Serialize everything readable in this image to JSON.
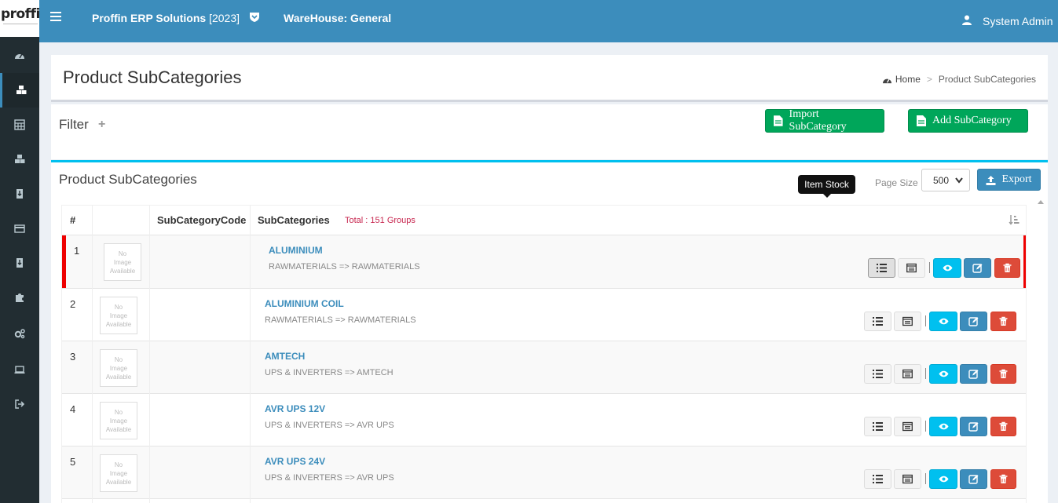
{
  "header": {
    "logo": "proffin",
    "app_title": "Proffin ERP Solutions",
    "app_year": "[2023]",
    "warehouse": "WareHouse: General",
    "user": "System Admin"
  },
  "sidebar": {
    "items": [
      {
        "icon": "dashboard-icon"
      },
      {
        "icon": "cubes-icon",
        "active": true
      },
      {
        "icon": "calculator-icon"
      },
      {
        "icon": "cubes-icon"
      },
      {
        "icon": "download-icon"
      },
      {
        "icon": "credit-card-icon"
      },
      {
        "icon": "download-icon"
      },
      {
        "icon": "puzzle-icon"
      },
      {
        "icon": "gears-icon"
      },
      {
        "icon": "laptop-icon"
      },
      {
        "icon": "sign-out-icon"
      }
    ]
  },
  "page": {
    "title": "Product SubCategories",
    "breadcrumb_home": "Home",
    "breadcrumb_current": "Product SubCategories"
  },
  "filter": {
    "label": "Filter",
    "plus": "+",
    "import_label": "Import SubCategory",
    "add_label": "Add SubCategory"
  },
  "list": {
    "title": "Product SubCategories",
    "page_size_label": "Page Size",
    "page_size_value": "500",
    "export_label": "Export",
    "columns": {
      "num": "#",
      "code": "SubCategoryCode",
      "name": "SubCategories",
      "total": "Total : 151 Groups"
    },
    "no_image": [
      "No",
      "Image",
      "Available"
    ],
    "tooltip": "Item Stock",
    "rows": [
      {
        "num": "1",
        "code": "",
        "name": "ALUMINIUM",
        "path": "RAWMATERIALS => RAWMATERIALS"
      },
      {
        "num": "2",
        "code": "",
        "name": "ALUMINIUM COIL",
        "path": "RAWMATERIALS => RAWMATERIALS"
      },
      {
        "num": "3",
        "code": "",
        "name": "AMTECH",
        "path": "UPS & INVERTERS => AMTECH"
      },
      {
        "num": "4",
        "code": "",
        "name": "AVR UPS 12V",
        "path": "UPS & INVERTERS => AVR UPS"
      },
      {
        "num": "5",
        "code": "",
        "name": "AVR UPS 24V",
        "path": "UPS & INVERTERS => AVR UPS"
      }
    ]
  },
  "colors": {
    "header": "#3c8dbc",
    "sidebar": "#222d32",
    "green": "#00a65a",
    "cyan": "#00c0ef",
    "red": "#dd4b39"
  }
}
